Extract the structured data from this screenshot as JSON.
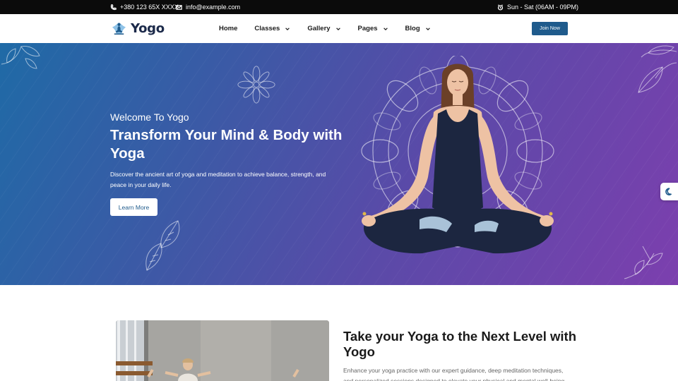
{
  "topbar": {
    "phone": "+380 123 65X XXXX",
    "email": "info@example.com",
    "hours": "Sun - Sat (06AM - 09PM)"
  },
  "nav": {
    "brand": "Yogo",
    "items": [
      {
        "label": "Home",
        "has_dropdown": false
      },
      {
        "label": "Classes",
        "has_dropdown": true
      },
      {
        "label": "Gallery",
        "has_dropdown": true
      },
      {
        "label": "Pages",
        "has_dropdown": true
      },
      {
        "label": "Blog",
        "has_dropdown": true
      }
    ],
    "cta": "Join Now"
  },
  "hero": {
    "eyebrow": "Welcome To Yogo",
    "title": "Transform Your Mind & Body with Yoga",
    "description": "Discover the ancient art of yoga and meditation to achieve balance, strength, and peace in your daily life.",
    "button": "Learn More"
  },
  "about": {
    "title": "Take your Yoga to the Next Level with Yogo",
    "text": "Enhance your yoga practice with our expert guidance, deep meditation techniques, and personalized sessions designed to elevate your physical and mental well-being. At Yogo,"
  },
  "colors": {
    "primary": "#1f5b8c",
    "topbar": "#0b0b0b",
    "hero_start": "#1f6aa6",
    "hero_end": "#7c3fae"
  },
  "icons": {
    "phone": "phone-icon",
    "email": "mail-icon",
    "hours": "alarm-clock-icon",
    "dropdown": "chevron-down-icon",
    "theme": "moon-icon"
  }
}
